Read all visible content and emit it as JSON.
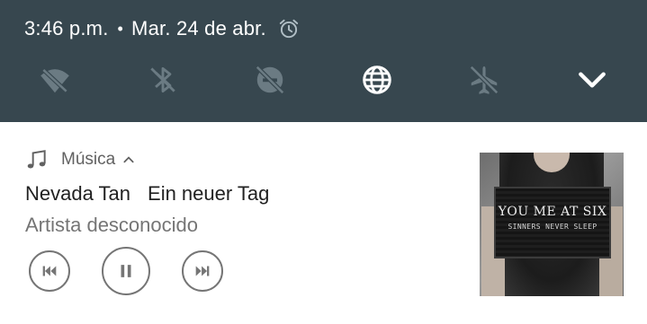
{
  "status_bar": {
    "time": "3:46 p.m.",
    "separator": "•",
    "date": "Mar. 24 de abr."
  },
  "quick_settings": {
    "tiles": [
      {
        "name": "wifi-off-icon"
      },
      {
        "name": "bluetooth-off-icon"
      },
      {
        "name": "do-not-disturb-off-icon"
      },
      {
        "name": "globe-icon"
      },
      {
        "name": "airplane-mode-off-icon"
      },
      {
        "name": "chevron-down-icon"
      }
    ],
    "colors": {
      "background": "#37474f",
      "active": "#ffffff",
      "inactive": "#6b7b83"
    }
  },
  "notification": {
    "app_name": "Música",
    "song": {
      "title": "Nevada Tan",
      "subtitle": "Ein neuer Tag"
    },
    "artist": "Artista desconocido",
    "controls": [
      "previous-icon",
      "pause-icon",
      "next-icon"
    ],
    "album_art": {
      "band": "YOU ME AT SIX",
      "album": "SINNERS NEVER SLEEP"
    }
  }
}
